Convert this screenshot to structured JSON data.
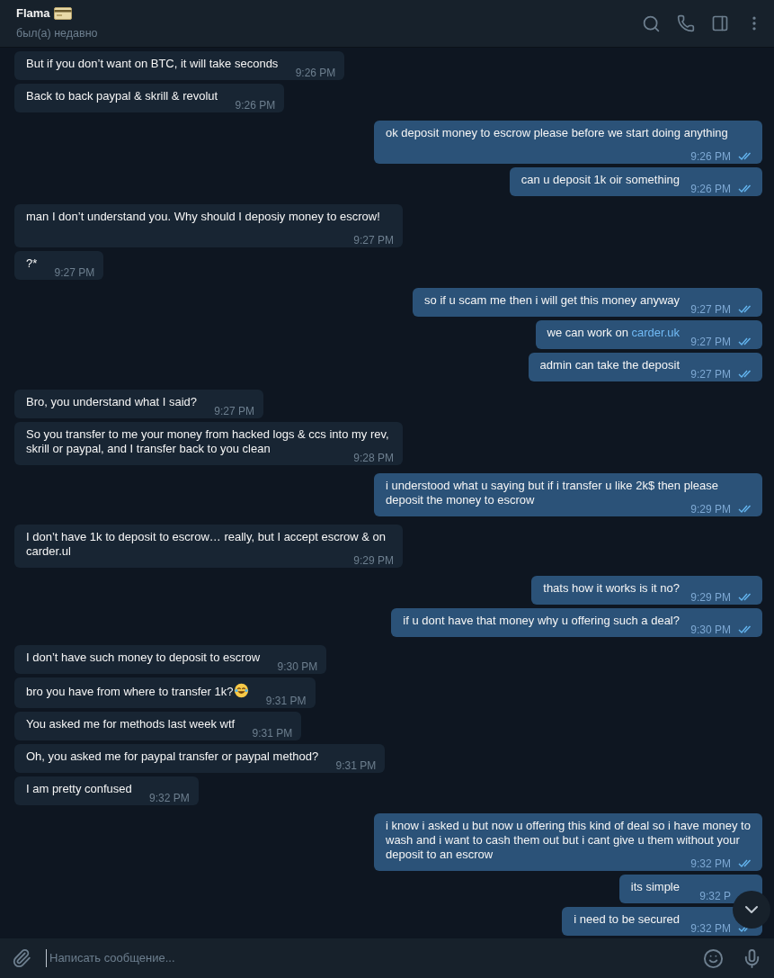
{
  "header": {
    "title": "Flama",
    "card_icon": true,
    "status": "был(а) недавно"
  },
  "messages": [
    {
      "out": false,
      "text": "But if you don’t want on BTC, it will take seconds",
      "time": "9:26 PM"
    },
    {
      "out": false,
      "text": "Back to back paypal & skrill & revolut",
      "time": "9:26 PM"
    },
    {
      "out": true,
      "read": true,
      "text": "ok deposit money to escrow please before we start doing anything",
      "time": "9:26 PM"
    },
    {
      "out": true,
      "read": true,
      "text": "can u deposit 1k oir something",
      "time": "9:26 PM"
    },
    {
      "out": false,
      "text": "man I don’t understand you. Why should I deposiy money to escrow!",
      "time": "9:27 PM"
    },
    {
      "out": false,
      "text": "?*",
      "time": "9:27 PM"
    },
    {
      "out": true,
      "read": true,
      "text": "so if u scam me then i will get this money anyway",
      "time": "9:27 PM"
    },
    {
      "out": true,
      "read": true,
      "text": "we can work on",
      "link": "carder.uk",
      "time": "9:27 PM"
    },
    {
      "out": true,
      "read": true,
      "text": "admin can take the deposit",
      "time": "9:27 PM"
    },
    {
      "out": false,
      "text": "Bro, you understand what I said?",
      "time": "9:27 PM"
    },
    {
      "out": false,
      "text": "So you transfer to me your money from hacked logs & ccs into my rev, skrill or paypal, and I transfer back to you clean",
      "time": "9:28 PM"
    },
    {
      "out": true,
      "read": true,
      "text": "i understood what u saying but if i transfer u like 2k$ then please deposit the money to escrow",
      "time": "9:29 PM"
    },
    {
      "out": false,
      "text": "I don’t have 1k to deposit to escrow… really, but I accept escrow & on carder.ul",
      "time": "9:29 PM"
    },
    {
      "out": true,
      "read": true,
      "text": "thats how it works is it no?",
      "time": "9:29 PM"
    },
    {
      "out": true,
      "read": true,
      "text": "if u dont have that money why u offering such a deal?",
      "time": "9:30 PM"
    },
    {
      "out": false,
      "text": "I don’t have such money to deposit to escrow",
      "time": "9:30 PM"
    },
    {
      "out": false,
      "text": "bro you have from where to transfer 1k?",
      "laughing_emoji": true,
      "time": "9:31 PM"
    },
    {
      "out": false,
      "text": "You asked me for methods last week wtf",
      "time": "9:31 PM"
    },
    {
      "out": false,
      "text": "Oh, you asked me for paypal transfer or paypal method?",
      "time": "9:31 PM"
    },
    {
      "out": false,
      "text": "I am pretty confused",
      "time": "9:32 PM"
    },
    {
      "out": true,
      "read": true,
      "text": "i know i asked u but now u offering this kind of deal so i have money to wash and i want to cash them out but i cant give u them without your deposit to an escrow",
      "time": "9:32 PM"
    },
    {
      "out": true,
      "text": "its simple",
      "time": "9:32 P"
    },
    {
      "out": true,
      "read": true,
      "text": "i need to be secured",
      "time": "9:32 PM"
    }
  ],
  "composer": {
    "placeholder": "Написать сообщение..."
  }
}
